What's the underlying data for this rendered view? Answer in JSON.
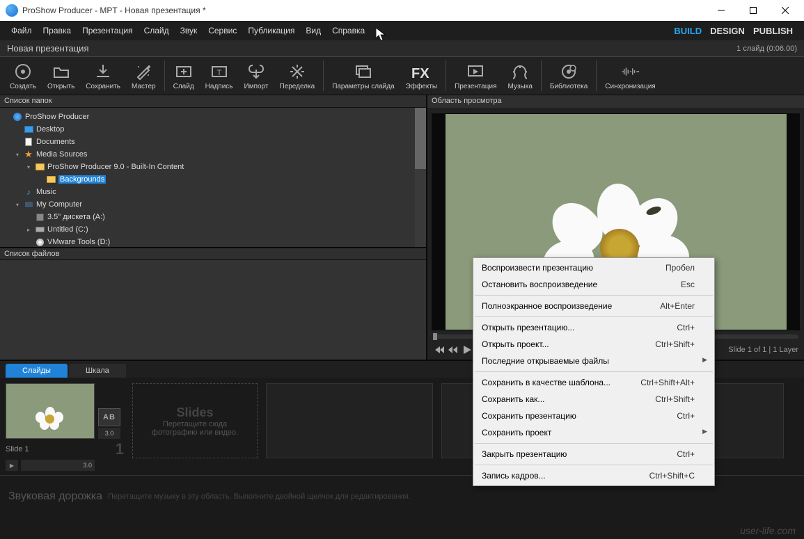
{
  "titlebar": {
    "title": "ProShow Producer - MPT - Новая презентация *"
  },
  "menubar": [
    "Файл",
    "Правка",
    "Презентация",
    "Слайд",
    "Звук",
    "Сервис",
    "Публикация",
    "Вид",
    "Справка"
  ],
  "menuRight": [
    {
      "label": "BUILD",
      "active": true
    },
    {
      "label": "DESIGN",
      "active": false
    },
    {
      "label": "PUBLISH",
      "active": false
    }
  ],
  "subheader": {
    "title": "Новая презентация",
    "status": "1 слайд (0:06.00)"
  },
  "toolbar": [
    {
      "key": "create",
      "label": "Создать"
    },
    {
      "key": "open",
      "label": "Открыть"
    },
    {
      "key": "save",
      "label": "Сохранить"
    },
    {
      "key": "wizard",
      "label": "Мастер"
    },
    {
      "sep": true
    },
    {
      "key": "slide",
      "label": "Слайд"
    },
    {
      "key": "caption",
      "label": "Надпись"
    },
    {
      "key": "import",
      "label": "Импорт"
    },
    {
      "key": "remix",
      "label": "Переделка"
    },
    {
      "sep": true
    },
    {
      "key": "slideopts",
      "label": "Параметры слайда"
    },
    {
      "key": "fx",
      "label": "Эффекты"
    },
    {
      "sep": true
    },
    {
      "key": "show",
      "label": "Презентация"
    },
    {
      "key": "music",
      "label": "Музыка"
    },
    {
      "sep": true
    },
    {
      "key": "library",
      "label": "Библиотека"
    },
    {
      "sep": true
    },
    {
      "key": "sync",
      "label": "Синхронизация"
    }
  ],
  "panes": {
    "folders": "Список папок",
    "files": "Список файлов",
    "preview": "Область просмотра"
  },
  "folderTree": [
    {
      "indent": 0,
      "icon": "app",
      "label": "ProShow Producer",
      "expand": ""
    },
    {
      "indent": 1,
      "icon": "desktop",
      "label": "Desktop",
      "expand": ""
    },
    {
      "indent": 1,
      "icon": "doc",
      "label": "Documents",
      "expand": ""
    },
    {
      "indent": 1,
      "icon": "star",
      "label": "Media Sources",
      "expand": "▾"
    },
    {
      "indent": 2,
      "icon": "folder",
      "label": "ProShow Producer 9.0 - Built-In Content",
      "expand": "▾"
    },
    {
      "indent": 3,
      "icon": "folder",
      "label": "Backgrounds",
      "expand": "",
      "selected": true
    },
    {
      "indent": 1,
      "icon": "music",
      "label": "Music",
      "expand": ""
    },
    {
      "indent": 1,
      "icon": "computer",
      "label": "My Computer",
      "expand": "▾"
    },
    {
      "indent": 2,
      "icon": "floppy",
      "label": "3.5\" дискета (A:)",
      "expand": ""
    },
    {
      "indent": 2,
      "icon": "drive",
      "label": "Untitled (C:)",
      "expand": "▸"
    },
    {
      "indent": 2,
      "icon": "cd",
      "label": "VMware Tools (D:)",
      "expand": ""
    }
  ],
  "previewControls": {
    "info": "Slide 1 of 1  |  1 Layer"
  },
  "tabs": [
    {
      "label": "Слайды",
      "active": true
    },
    {
      "label": "Шкала",
      "active": false
    }
  ],
  "slide": {
    "name": "Slide 1",
    "num": "1",
    "duration": "3.0",
    "transition": "AB",
    "trans_time": "3.0"
  },
  "slidesPlaceholder": {
    "title": "Slides",
    "line1": "Перетащите сюда",
    "line2": "фотографию или видео."
  },
  "soundtrack": {
    "title": "Звуковая дорожка",
    "hint": "Перетащите музыку в эту область. Выполните двойной щелчок для редактирования."
  },
  "contextMenu": [
    {
      "label": "Воспроизвести презентацию",
      "shortcut": "Пробел"
    },
    {
      "label": "Остановить воспроизведение",
      "shortcut": "Esc"
    },
    {
      "sep": true
    },
    {
      "label": "Полноэкранное воспроизведение",
      "shortcut": "Alt+Enter"
    },
    {
      "sep": true
    },
    {
      "label": "Открыть презентацию...",
      "shortcut": "Ctrl+"
    },
    {
      "label": "Открыть проект...",
      "shortcut": "Ctrl+Shift+"
    },
    {
      "label": "Последние открываемые файлы",
      "submenu": true
    },
    {
      "sep": true
    },
    {
      "label": "Сохранить в качестве шаблона...",
      "shortcut": "Ctrl+Shift+Alt+"
    },
    {
      "label": "Сохранить как...",
      "shortcut": "Ctrl+Shift+"
    },
    {
      "label": "Сохранить презентацию",
      "shortcut": "Ctrl+"
    },
    {
      "label": "Сохранить проект",
      "submenu": true
    },
    {
      "sep": true
    },
    {
      "label": "Закрыть презентацию",
      "shortcut": "Ctrl+"
    },
    {
      "sep": true
    },
    {
      "label": "Запись кадров...",
      "shortcut": "Ctrl+Shift+C"
    }
  ],
  "watermark": "user-life.com"
}
